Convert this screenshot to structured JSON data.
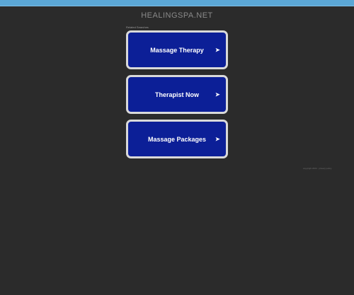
{
  "header": {
    "site_title": "HEALINGSPA.NET"
  },
  "links": {
    "section_label": "Related Searches",
    "items": [
      {
        "label": "Massage Therapy",
        "arrow": "➤"
      },
      {
        "label": "Therapist Now",
        "arrow": "➤"
      },
      {
        "label": "Massage Packages",
        "arrow": "➤"
      }
    ]
  },
  "footer": {
    "text": "copyright 2024 · privacy policy"
  },
  "colors": {
    "background": "#2b2b2b",
    "top_bar": "#5ba7d6",
    "button_fill": "#0c1f97",
    "button_border": "#d9d9d9"
  }
}
